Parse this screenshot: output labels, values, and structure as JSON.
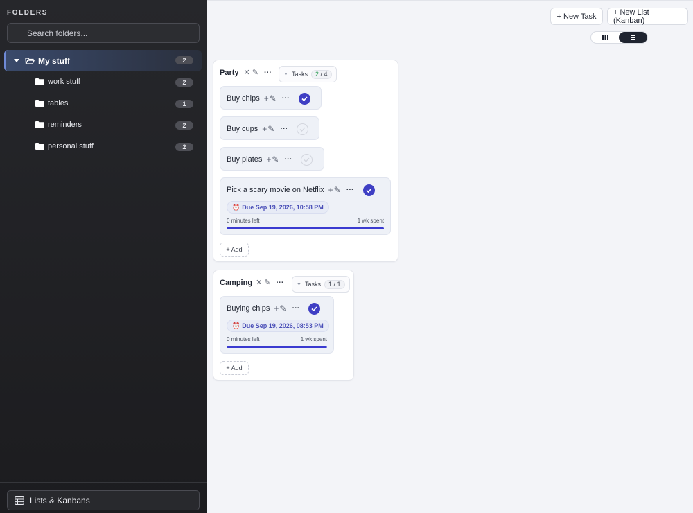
{
  "sidebar": {
    "title": "FOLDERS",
    "search_placeholder": "Search folders...",
    "root": {
      "label": "My stuff",
      "count": "2"
    },
    "children": [
      {
        "label": "work stuff",
        "count": "2"
      },
      {
        "label": "tables",
        "count": "1"
      },
      {
        "label": "reminders",
        "count": "2"
      },
      {
        "label": "personal stuff",
        "count": "2"
      }
    ],
    "footer_label": "Lists & Kanbans"
  },
  "toolbar": {
    "new_task": "+ New Task",
    "new_list": "+ New List (Kanban)"
  },
  "lists": [
    {
      "name": "Party",
      "tasks_label": "Tasks",
      "done": "2",
      "total": "4",
      "tasks": [
        {
          "title": "Buy chips",
          "done": true
        },
        {
          "title": "Buy cups",
          "done": false
        },
        {
          "title": "Buy plates",
          "done": false
        },
        {
          "title": "Pick a scary movie on Netflix",
          "done": true,
          "due": "Due Sep 19, 2026, 10:58 PM",
          "left": "0 minutes left",
          "spent": "1 wk spent",
          "progress": 1.0
        }
      ],
      "add_label": "+ Add"
    },
    {
      "name": "Camping",
      "tasks_label": "Tasks",
      "done": "1",
      "total": "1",
      "tasks": [
        {
          "title": "Buying chips",
          "done": true,
          "due": "Due Sep 19, 2026, 08:53 PM",
          "left": "0 minutes left",
          "spent": "1 wk spent",
          "progress": 1.0
        }
      ],
      "add_label": "+ Add"
    }
  ],
  "colors": {
    "accent": "#3f3fc4",
    "sidebar_bg": "#1f1f22",
    "progress": "#3a3ad0",
    "done_green": "#2f9e57"
  }
}
